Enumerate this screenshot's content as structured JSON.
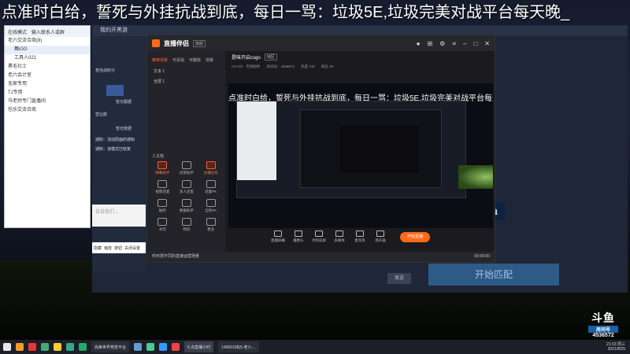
{
  "marquee": "点准时白给，誓死与外挂抗战到底，每日一骂：垃圾5E,垃圾完美对战平台每天晚_",
  "qq": {
    "top": [
      "在线模式",
      "输入联系人或群"
    ],
    "rows": [
      {
        "text": "老六交流合商(8)",
        "sub": false,
        "sel": false
      },
      {
        "text": "舞iGG",
        "sub": true,
        "sel": true
      },
      {
        "text": "工具人021",
        "sub": true,
        "sel": false
      },
      {
        "text": "勇毛社士",
        "sub": false,
        "sel": false
      },
      {
        "text": "老六会计室",
        "sub": false,
        "sel": false
      },
      {
        "text": "无家专用",
        "sub": false,
        "sel": false
      },
      {
        "text": "TJ专用",
        "sub": false,
        "sel": false
      },
      {
        "text": "马老师专门直播间",
        "sub": false,
        "sel": false
      },
      {
        "text": "包乐交流合商",
        "sub": false,
        "sel": false
      }
    ]
  },
  "platform": {
    "header": "我的开黑游",
    "side_labels": [
      "我的开黑游",
      "普佳战积分",
      "星级",
      "暂无跟据",
      "营业额",
      "暂无数据"
    ],
    "msgs": [
      "通知：活动层面的通知",
      "通知：该模式已收复"
    ],
    "input_placeholder": "告诉我们...",
    "taskrow": [
      "隐藏",
      "缩放",
      "按钮",
      "关闭设置"
    ],
    "match_btn": "开始匹配",
    "small_btn": "发送",
    "ad": "斗鱼"
  },
  "app": {
    "title": "直播伴侣",
    "version": "旗舰",
    "tabs": [
      "推荐场景",
      "可添加",
      "可删除",
      "场景"
    ],
    "scenes": [
      "文本 1",
      "全屏 1"
    ],
    "tools_label": "工具箱",
    "tools": [
      {
        "label": "弹幕助手",
        "hot": true
      },
      {
        "label": "房管助手",
        "hot": false
      },
      {
        "label": "主播任务",
        "hot": true
      },
      {
        "label": "视频连麦",
        "hot": false
      },
      {
        "label": "多人连麦",
        "hot": false
      },
      {
        "label": "连麦PK",
        "hot": false
      },
      {
        "label": "抽奖",
        "hot": false
      },
      {
        "label": "数据助手",
        "hot": false
      },
      {
        "label": "全民PK",
        "hot": false
      },
      {
        "label": "水印",
        "hot": false
      },
      {
        "label": "特效",
        "hot": false
      },
      {
        "label": "更多",
        "hot": false
      }
    ],
    "room_title": "是味开启csgo",
    "room_tag": "地区",
    "stats": [
      "CS:GO · 无线组件",
      "房间号：4536572",
      "热度 740",
      "粉丝 46"
    ],
    "preview_subtitle": "点准时白给，誓死与外挂抗战到底，每日一骂：垃圾5E,垃圾完美对战平台每天晚_",
    "bottom": [
      "直播屏幕",
      "摄像头",
      "手机投屏",
      "多媒体",
      "麦克风",
      "扬声器"
    ],
    "start_btn": "开始直播",
    "status_msg": "你可把不同的直接运营场景",
    "status_time": "00:00:00"
  },
  "douyu": {
    "logo": "斗鱼",
    "room_label": "房间号",
    "room_no": "4536572"
  },
  "taskbar": {
    "windows": [
      "完美世界竞技平台",
      "5.点直播小时",
      "14560168(5-老六…"
    ],
    "time": "21:03 周三",
    "date": "2021/8/25"
  }
}
